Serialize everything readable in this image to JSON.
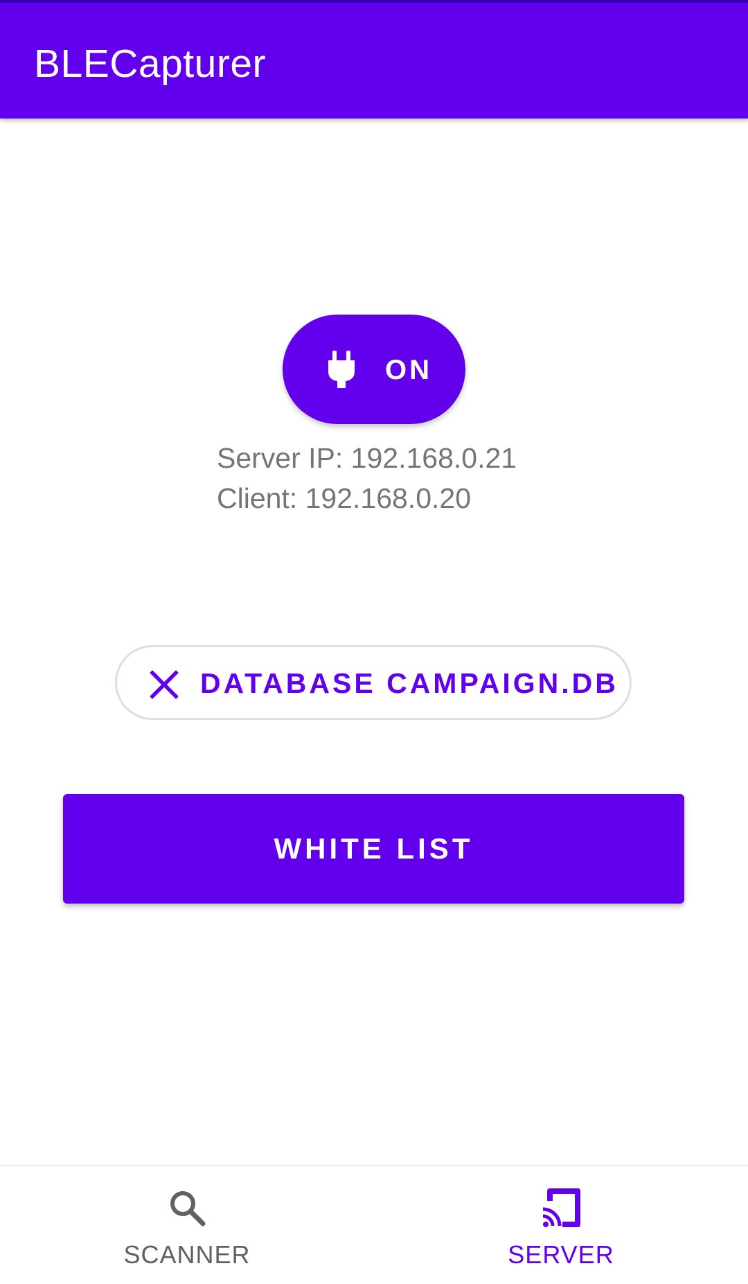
{
  "app_bar": {
    "title": "BLECapturer"
  },
  "server_toggle": {
    "label": "ON",
    "icon": "power-plug-icon",
    "state": "on"
  },
  "server_info": {
    "server_ip_line": "Server IP: 192.168.0.21",
    "client_line": "Client: 192.168.0.20"
  },
  "database_chip": {
    "label": "DATABASE CAMPAIGN.DB",
    "icon": "close-icon"
  },
  "white_list_button": {
    "label": "WHITE LIST"
  },
  "bottom_nav": {
    "items": [
      {
        "label": "SCANNER",
        "icon": "search-icon",
        "selected": false
      },
      {
        "label": "SERVER",
        "icon": "cast-icon",
        "selected": true
      }
    ]
  },
  "colors": {
    "primary": "#6200ee",
    "status_bar": "#3700b3",
    "secondary_text": "#757575",
    "nav_inactive": "#616161"
  }
}
